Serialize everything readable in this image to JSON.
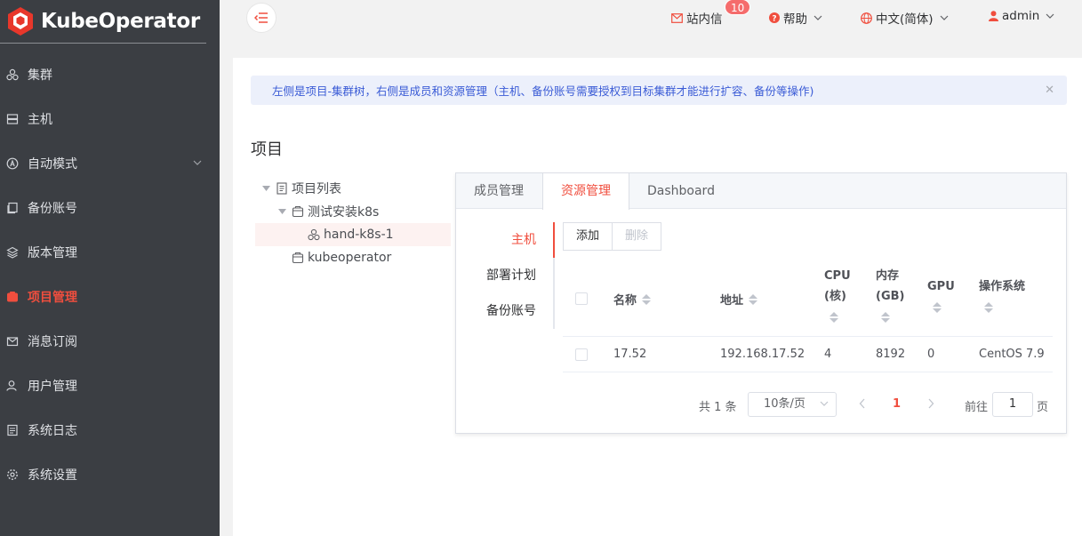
{
  "app": {
    "name": "KubeOperator"
  },
  "sidebar": {
    "items": [
      {
        "label": "集群",
        "icon": "cluster-icon"
      },
      {
        "label": "主机",
        "icon": "server-icon"
      },
      {
        "label": "自动模式",
        "icon": "auto-mode-icon",
        "expandable": true
      },
      {
        "label": "备份账号",
        "icon": "backup-account-icon"
      },
      {
        "label": "版本管理",
        "icon": "version-icon"
      },
      {
        "label": "项目管理",
        "icon": "project-icon",
        "active": true
      },
      {
        "label": "消息订阅",
        "icon": "message-icon"
      },
      {
        "label": "用户管理",
        "icon": "user-icon"
      },
      {
        "label": "系统日志",
        "icon": "log-icon"
      },
      {
        "label": "系统设置",
        "icon": "settings-icon"
      }
    ]
  },
  "header": {
    "messages_label": "站内信",
    "messages_badge": "10",
    "help_label": "帮助",
    "language_label": "中文(简体)",
    "user_label": "admin"
  },
  "alert": {
    "text": "左侧是项目-集群树，右侧是成员和资源管理（主机、备份账号需要授权到目标集群才能进行扩容、备份等操作)"
  },
  "page_title": "项目",
  "tree": {
    "root": "项目列表",
    "project": "测试安装k8s",
    "cluster": "hand-k8s-1",
    "project2": "kubeoperator"
  },
  "tabs": [
    "成员管理",
    "资源管理",
    "Dashboard"
  ],
  "active_tab": 1,
  "subnav": [
    "主机",
    "部署计划",
    "备份账号"
  ],
  "buttons": {
    "add": "添加",
    "delete": "删除"
  },
  "table": {
    "headers": {
      "name": "名称",
      "address": "地址",
      "cpu_line1": "CPU",
      "cpu_line2": "(核)",
      "mem_line1": "内存",
      "mem_line2": "(GB)",
      "gpu": "GPU",
      "os": "操作系统"
    },
    "rows": [
      {
        "name": "17.52",
        "address": "192.168.17.52",
        "cpu": "4",
        "memory": "8192",
        "gpu": "0",
        "os": "CentOS 7.9"
      }
    ]
  },
  "pagination": {
    "total": "共 1 条",
    "page_size": "10条/页",
    "current_page": "1",
    "goto_label": "前往",
    "goto_value": "1",
    "page_suffix": "页"
  },
  "colors": {
    "accent": "#f04e3e",
    "sidebar_bg": "#3b3e43",
    "alert_text": "#3a5bd6"
  }
}
